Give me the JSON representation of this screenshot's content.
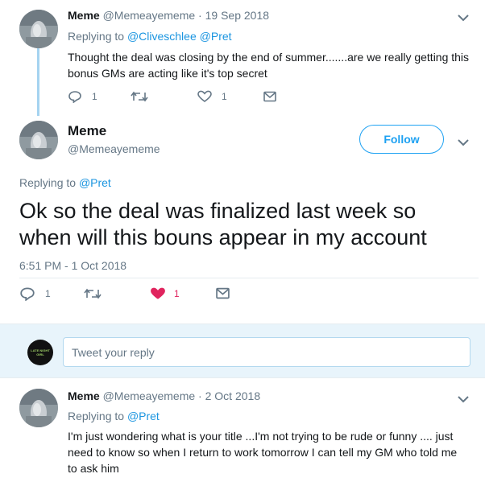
{
  "colors": {
    "link": "#1b95e0",
    "like": "#e0245e",
    "muted": "#657786",
    "thread_line": "#a5d3f0",
    "reply_bg": "#e8f4fb"
  },
  "tweet1": {
    "name": "Meme",
    "handle": "@Memeayememe",
    "separator": "·",
    "date": "19 Sep 2018",
    "replying_prefix": "Replying to",
    "replying_to": [
      "@Cliveschlee",
      "@Pret"
    ],
    "text_line1": "Thought the deal was closing by the end of summer.......are we really getting this",
    "text_line2": "bonus GMs are acting like it's top secret",
    "reply_count": "1",
    "like_count": "1"
  },
  "main_tweet": {
    "name": "Meme",
    "handle": "@Memeayememe",
    "follow_label": "Follow",
    "replying_prefix": "Replying to",
    "replying_to": "@Pret",
    "text_line1": "Ok so the deal was finalized last week so",
    "text_line2": "when will this bouns appear in my account",
    "timestamp": "6:51 PM - 1 Oct 2018",
    "reply_count": "1",
    "like_count": "1"
  },
  "reply_box": {
    "placeholder": "Tweet your reply",
    "avatar_text_line1": "LATE NIGHT",
    "avatar_text_line2": "GIRL"
  },
  "tweet3": {
    "name": "Meme",
    "handle": "@Memeayememe",
    "separator": "·",
    "date": "2 Oct 2018",
    "replying_prefix": "Replying to",
    "replying_to": "@Pret",
    "text_line1": "I'm just wondering what is your title ...I'm not trying to be rude or funny .... just",
    "text_line2": "need to know so when I return to work tomorrow I can tell my GM who told me",
    "text_line3": "to ask him"
  },
  "icons": {
    "reply": "reply-icon",
    "retweet": "retweet-icon",
    "like": "heart-icon",
    "dm": "envelope-icon",
    "caret": "chevron-down-icon"
  }
}
